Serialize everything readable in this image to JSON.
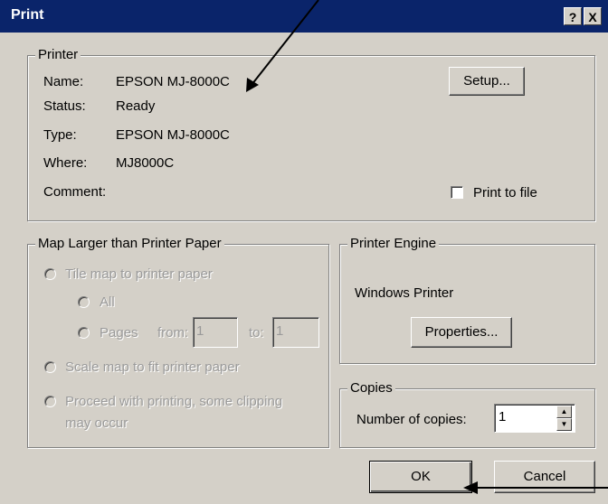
{
  "window": {
    "title": "Print",
    "help_label": "?",
    "close_label": "X"
  },
  "printer": {
    "legend": "Printer",
    "name_label": "Name:",
    "name_value": "EPSON MJ-8000C",
    "status_label": "Status:",
    "status_value": "Ready",
    "type_label": "Type:",
    "type_value": "EPSON MJ-8000C",
    "where_label": "Where:",
    "where_value": "MJ8000C",
    "comment_label": "Comment:",
    "setup_button": "Setup...",
    "print_to_file_label": "Print to file",
    "print_to_file_checked": false
  },
  "map_larger": {
    "legend": "Map Larger than Printer Paper",
    "tile_label": "Tile map to printer paper",
    "all_label": "All",
    "pages_label": "Pages",
    "from_label": "from:",
    "from_value": "1",
    "to_label": "to:",
    "to_value": "1",
    "scale_label": "Scale map to fit printer paper",
    "proceed_label_line1": "Proceed with printing, some clipping",
    "proceed_label_line2": "may occur"
  },
  "engine": {
    "legend": "Printer Engine",
    "engine_name": "Windows Printer",
    "properties_button": "Properties..."
  },
  "copies": {
    "legend": "Copies",
    "number_label": "Number of copies:",
    "number_value": "1"
  },
  "buttons": {
    "ok": "OK",
    "cancel": "Cancel"
  }
}
